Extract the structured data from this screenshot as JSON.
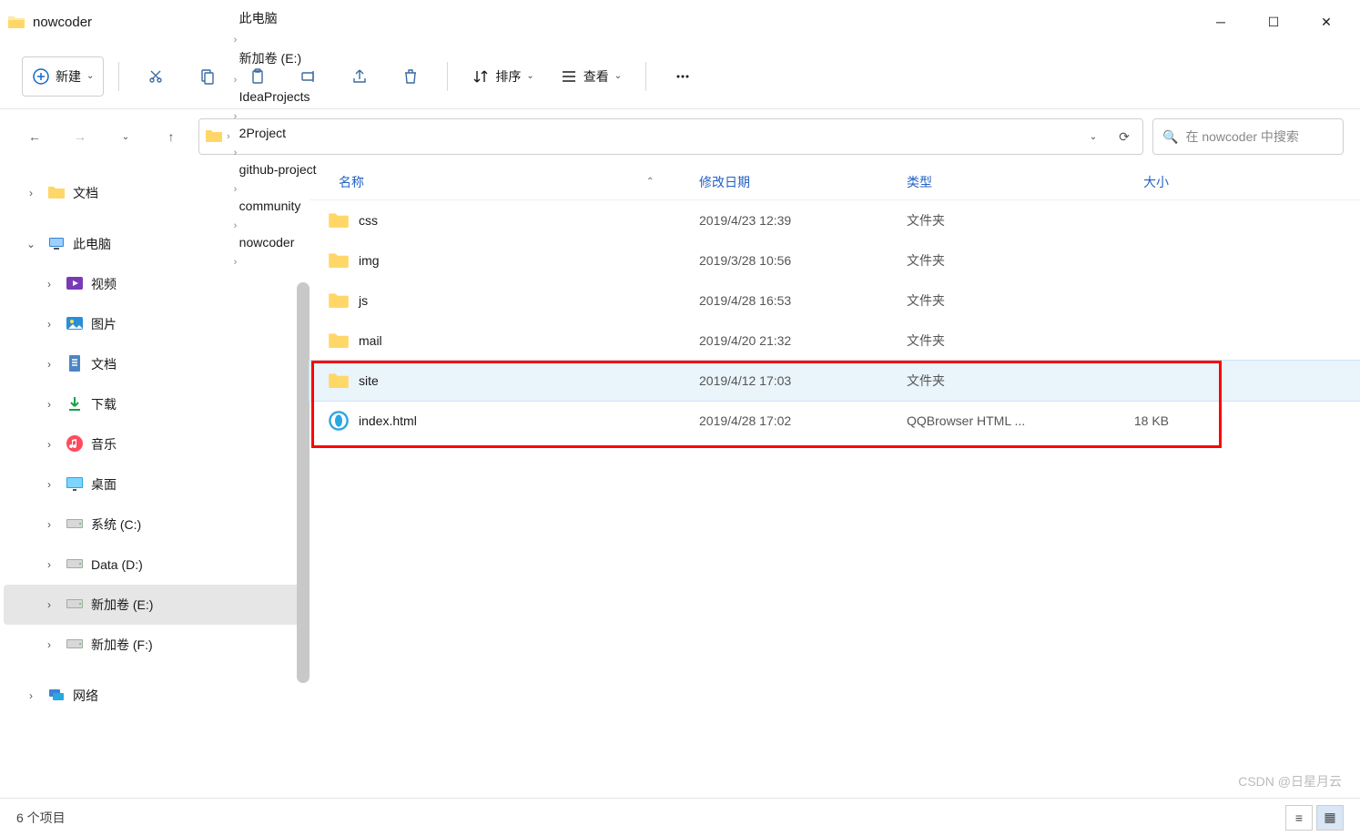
{
  "window": {
    "title": "nowcoder"
  },
  "toolbar": {
    "new_label": "新建",
    "sort_label": "排序",
    "view_label": "查看"
  },
  "breadcrumbs": [
    "此电脑",
    "新加卷 (E:)",
    "IdeaProjects",
    "2Project",
    "github-project",
    "community",
    "nowcoder"
  ],
  "search": {
    "placeholder": "在 nowcoder 中搜索"
  },
  "sidebar": {
    "items": [
      {
        "label": "文档",
        "icon": "folder",
        "exp": "›",
        "level": 1
      },
      {
        "label": "此电脑",
        "icon": "pc",
        "exp": "⌄",
        "level": 1
      },
      {
        "label": "视频",
        "icon": "video",
        "exp": "›",
        "level": 2
      },
      {
        "label": "图片",
        "icon": "image",
        "exp": "›",
        "level": 2
      },
      {
        "label": "文档",
        "icon": "doc",
        "exp": "›",
        "level": 2
      },
      {
        "label": "下载",
        "icon": "download",
        "exp": "›",
        "level": 2
      },
      {
        "label": "音乐",
        "icon": "music",
        "exp": "›",
        "level": 2
      },
      {
        "label": "桌面",
        "icon": "desktop",
        "exp": "›",
        "level": 2
      },
      {
        "label": "系统 (C:)",
        "icon": "drive",
        "exp": "›",
        "level": 2
      },
      {
        "label": "Data (D:)",
        "icon": "drive",
        "exp": "›",
        "level": 2
      },
      {
        "label": "新加卷 (E:)",
        "icon": "drive",
        "exp": "›",
        "level": 2,
        "selected": true
      },
      {
        "label": "新加卷 (F:)",
        "icon": "drive",
        "exp": "›",
        "level": 2
      },
      {
        "label": "网络",
        "icon": "network",
        "exp": "›",
        "level": 1
      }
    ]
  },
  "columns": {
    "name": "名称",
    "date": "修改日期",
    "type": "类型",
    "size": "大小"
  },
  "files": [
    {
      "name": "css",
      "date": "2019/4/23 12:39",
      "type": "文件夹",
      "size": "",
      "icon": "folder"
    },
    {
      "name": "img",
      "date": "2019/3/28 10:56",
      "type": "文件夹",
      "size": "",
      "icon": "folder"
    },
    {
      "name": "js",
      "date": "2019/4/28 16:53",
      "type": "文件夹",
      "size": "",
      "icon": "folder"
    },
    {
      "name": "mail",
      "date": "2019/4/20 21:32",
      "type": "文件夹",
      "size": "",
      "icon": "folder"
    },
    {
      "name": "site",
      "date": "2019/4/12 17:03",
      "type": "文件夹",
      "size": "",
      "icon": "folder",
      "selected": true
    },
    {
      "name": "index.html",
      "date": "2019/4/28 17:02",
      "type": "QQBrowser HTML ...",
      "size": "18 KB",
      "icon": "html"
    }
  ],
  "status": {
    "count": "6 个项目"
  },
  "watermark": "CSDN @日星月云"
}
